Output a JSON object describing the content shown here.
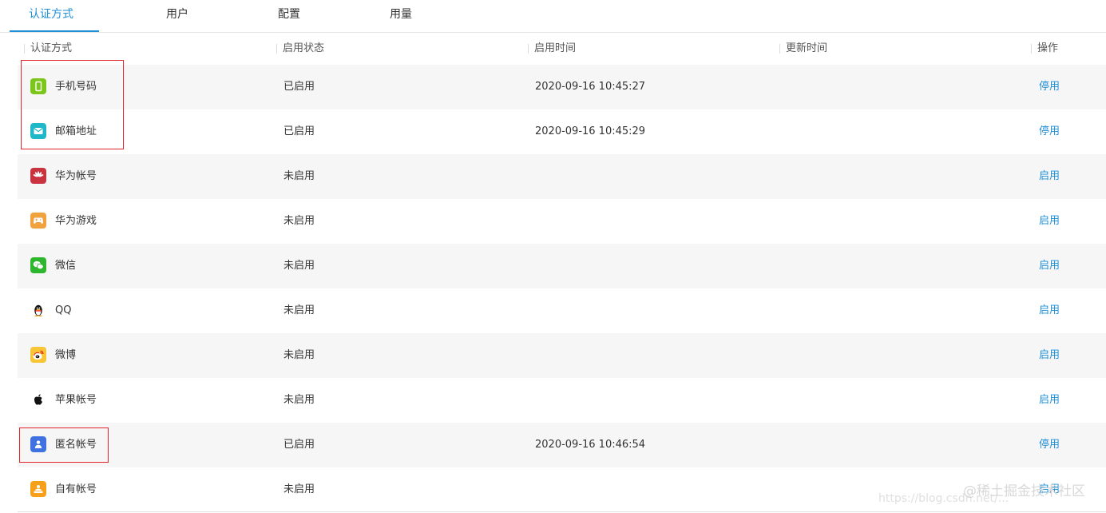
{
  "tabs": [
    {
      "label": "认证方式",
      "active": true
    },
    {
      "label": "用户",
      "active": false
    },
    {
      "label": "配置",
      "active": false
    },
    {
      "label": "用量",
      "active": false
    }
  ],
  "table": {
    "headers": [
      "认证方式",
      "启用状态",
      "启用时间",
      "更新时间",
      "操作"
    ],
    "rows": [
      {
        "name": "手机号码",
        "icon": "phone-icon",
        "status": "已启用",
        "enabled_time": "2020-09-16 10:45:27",
        "updated_time": "",
        "action": "停用"
      },
      {
        "name": "邮箱地址",
        "icon": "mail-icon",
        "status": "已启用",
        "enabled_time": "2020-09-16 10:45:29",
        "updated_time": "",
        "action": "停用"
      },
      {
        "name": "华为帐号",
        "icon": "huawei-icon",
        "status": "未启用",
        "enabled_time": "",
        "updated_time": "",
        "action": "启用"
      },
      {
        "name": "华为游戏",
        "icon": "gamepad-icon",
        "status": "未启用",
        "enabled_time": "",
        "updated_time": "",
        "action": "启用"
      },
      {
        "name": "微信",
        "icon": "wechat-icon",
        "status": "未启用",
        "enabled_time": "",
        "updated_time": "",
        "action": "启用"
      },
      {
        "name": "QQ",
        "icon": "qq-penguin-icon",
        "status": "未启用",
        "enabled_time": "",
        "updated_time": "",
        "action": "启用"
      },
      {
        "name": "微博",
        "icon": "weibo-icon",
        "status": "未启用",
        "enabled_time": "",
        "updated_time": "",
        "action": "启用"
      },
      {
        "name": "苹果帐号",
        "icon": "apple-icon",
        "status": "未启用",
        "enabled_time": "",
        "updated_time": "",
        "action": "启用"
      },
      {
        "name": "匿名帐号",
        "icon": "anonymous-user-icon",
        "status": "已启用",
        "enabled_time": "2020-09-16 10:46:54",
        "updated_time": "",
        "action": "停用"
      },
      {
        "name": "自有帐号",
        "icon": "own-account-icon",
        "status": "未启用",
        "enabled_time": "",
        "updated_time": "",
        "action": "启用"
      }
    ]
  },
  "watermark": {
    "line1": "@稀土掘金技术社区",
    "line2": "https://blog.csdn.net/..."
  },
  "colors": {
    "accent": "#1f8fd6",
    "annotation": "#e0252a"
  }
}
